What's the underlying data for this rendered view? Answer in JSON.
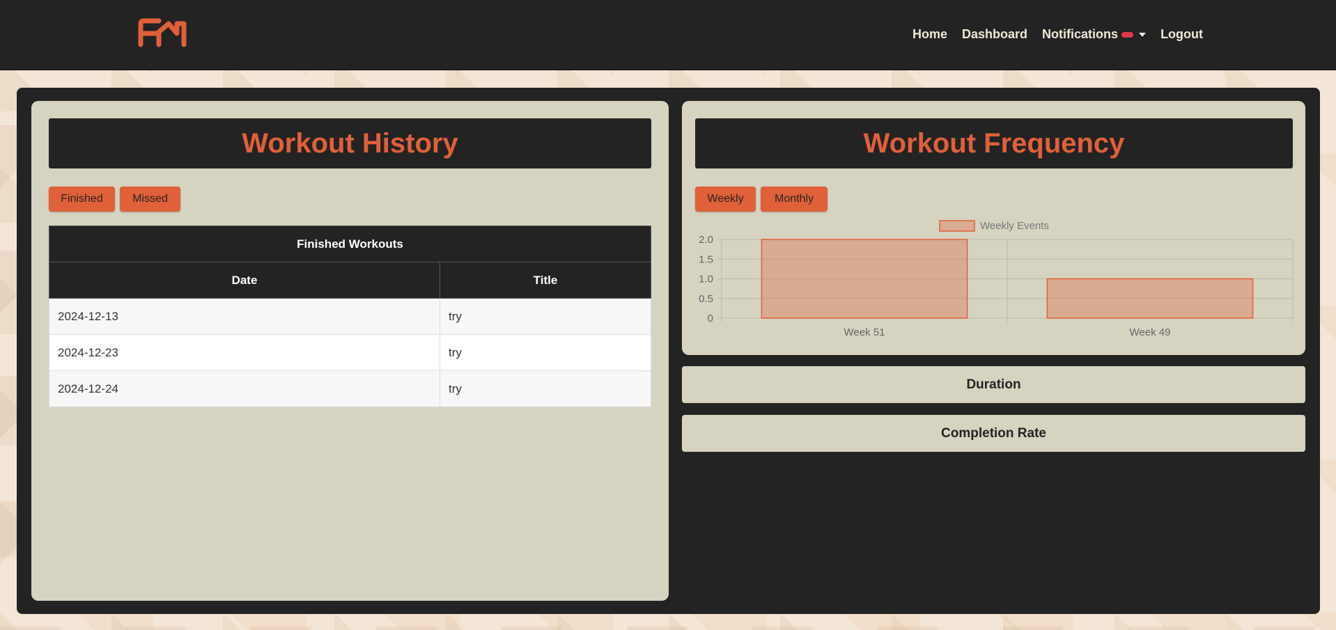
{
  "nav": {
    "links": [
      "Home",
      "Dashboard",
      "Notifications",
      "Logout"
    ]
  },
  "colors": {
    "accent": "#e0603a",
    "dark": "#232323",
    "card": "#d6d3c1",
    "badge": "#e0364a"
  },
  "history": {
    "title": "Workout History",
    "tabs": [
      "Finished",
      "Missed"
    ],
    "table_caption": "Finished Workouts",
    "columns": [
      "Date",
      "Title"
    ],
    "rows": [
      {
        "date": "2024-12-13",
        "title": "try"
      },
      {
        "date": "2024-12-23",
        "title": "try"
      },
      {
        "date": "2024-12-24",
        "title": "try"
      }
    ]
  },
  "frequency": {
    "title": "Workout Frequency",
    "tabs": [
      "Weekly",
      "Monthly"
    ]
  },
  "sections": {
    "duration": "Duration",
    "completion": "Completion Rate"
  },
  "chart_data": {
    "type": "bar",
    "categories": [
      "Week 51",
      "Week 49"
    ],
    "series": [
      {
        "name": "Weekly Events",
        "values": [
          2,
          1
        ]
      }
    ],
    "ylim": [
      0,
      2
    ],
    "yticks": [
      "0",
      "0.5",
      "1.0",
      "1.5",
      "2.0"
    ],
    "legend": "top-center",
    "grid": true
  }
}
